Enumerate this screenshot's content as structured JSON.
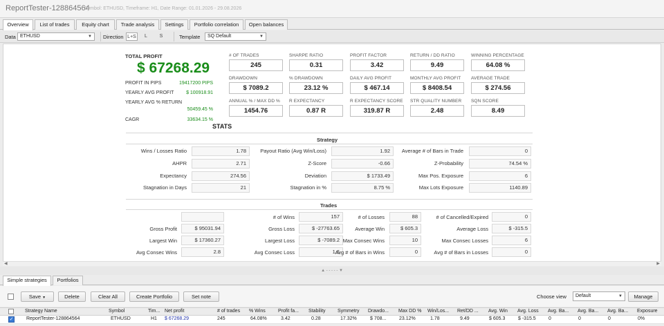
{
  "window": {
    "title": "ReportTester-128864564",
    "subtitle": "Symbol: ETHUSD, Timeframe: H1, Date Range: 01.01.2026 - 29.08.2026"
  },
  "tabs": [
    "Overview",
    "List of trades",
    "Equity chart",
    "Trade analysis",
    "Settings",
    "Portfolio correlation",
    "Open balances"
  ],
  "filter": {
    "data_label": "Data",
    "data_value": "ETHUSD",
    "direction_label": "Direction",
    "directions": [
      "L+S",
      "L",
      "S"
    ],
    "template_label": "Template",
    "template_value": "SQ Default"
  },
  "overview": {
    "total_profit_label": "TOTAL PROFIT",
    "total_profit": "$ 67268.29",
    "profit_in_pips_label": "PROFIT IN PIPS",
    "profit_in_pips": "19417200 PIPS",
    "yearly_avg_profit_label": "YEARLY AVG PROFIT",
    "yearly_avg_profit": "$ 100918.91",
    "yearly_avg_return_label": "YEARLY AVG % RETURN",
    "yearly_avg_return": "50459.45 %",
    "cagr_label": "CAGR",
    "cagr": "33634.15 %",
    "metrics": [
      {
        "label": "# OF TRADES",
        "value": "245"
      },
      {
        "label": "SHARPE RATIO",
        "value": "0.31"
      },
      {
        "label": "PROFIT FACTOR",
        "value": "3.42"
      },
      {
        "label": "RETURN / DD RATIO",
        "value": "9.49"
      },
      {
        "label": "WINNING PERCENTAGE",
        "value": "64.08 %"
      },
      {
        "label": "DRAWDOWN",
        "value": "$ 7089.2"
      },
      {
        "label": "% DRAWDOWN",
        "value": "23.12 %"
      },
      {
        "label": "DAILY AVG PROFIT",
        "value": "$ 467.14"
      },
      {
        "label": "MONTHLY AVG PROFIT",
        "value": "$ 8408.54"
      },
      {
        "label": "AVERAGE TRADE",
        "value": "$ 274.56"
      },
      {
        "label": "ANNUAL % / MAX DD %",
        "value": "1454.76"
      },
      {
        "label": "R EXPECTANCY",
        "value": "0.87 R"
      },
      {
        "label": "R EXPECTANCY SCORE",
        "value": "319.87 R"
      },
      {
        "label": "STR QUALITY NUMBER",
        "value": "2.48"
      },
      {
        "label": "SQN SCORE",
        "value": "8.49"
      }
    ]
  },
  "stats": {
    "title": "STATS",
    "strategy_title": "Strategy",
    "strategy": [
      {
        "label": "Wins / Losses Ratio",
        "value": "1.78"
      },
      {
        "label": "Payout Ratio (Avg Win/Loss)",
        "value": "1.92"
      },
      {
        "label": "Average # of Bars in Trade",
        "value": "0"
      },
      {
        "label": "AHPR",
        "value": "2.71"
      },
      {
        "label": "Z-Score",
        "value": "-0.66"
      },
      {
        "label": "Z-Probability",
        "value": "74.54 %"
      },
      {
        "label": "Expectancy",
        "value": "274.56"
      },
      {
        "label": "Deviation",
        "value": "$ 1733.49"
      },
      {
        "label": "Max Pos. Exposure",
        "value": "6"
      },
      {
        "label": "Stagnation in Days",
        "value": "21"
      },
      {
        "label": "Stagnation in %",
        "value": "8.75 %"
      },
      {
        "label": "Max Lots Exposure",
        "value": "1140.89"
      }
    ],
    "trades_title": "Trades",
    "trades": [
      {
        "label": "",
        "value": ""
      },
      {
        "label": "# of Wins",
        "value": "157"
      },
      {
        "label": "# of Losses",
        "value": "88"
      },
      {
        "label": "# of Cancelled/Expired",
        "value": "0"
      },
      {
        "label": "Gross Profit",
        "value": "$ 95031.94"
      },
      {
        "label": "Gross Loss",
        "value": "$ -27763.65"
      },
      {
        "label": "Average Win",
        "value": "$ 605.3"
      },
      {
        "label": "Average Loss",
        "value": "$ -315.5"
      },
      {
        "label": "Largest Win",
        "value": "$ 17360.27"
      },
      {
        "label": "Largest Loss",
        "value": "$ -7089.2"
      },
      {
        "label": "Max Consec Wins",
        "value": "10"
      },
      {
        "label": "Max Consec Losses",
        "value": "6"
      },
      {
        "label": "Avg Consec Wins",
        "value": "2.8"
      },
      {
        "label": "Avg Consec Loss",
        "value": "1.6"
      },
      {
        "label": "Avg # of Bars in Wins",
        "value": "0"
      },
      {
        "label": "Avg # of Bars in Losses",
        "value": "0"
      }
    ]
  },
  "splitter_glyph": "▲ - - - - - ▼",
  "bottom": {
    "tabs": [
      "Simple strategies",
      "Portfolios"
    ],
    "buttons": {
      "save": "Save",
      "delete": "Delete",
      "clear_all": "Clear All",
      "create_portfolio": "Create Portfolio",
      "set_note": "Set note",
      "manage": "Manage"
    },
    "choose_view_label": "Choose view",
    "choose_view_value": "Default",
    "columns": [
      "Strategy Name",
      "Symbol",
      "Tim...",
      "Net profit",
      "# of trades",
      "% Wins",
      "Profit fa...",
      "Stability",
      "Symmetry",
      "Drawdo...",
      "Max DD %",
      "Win/Los...",
      "Ret/DD ...",
      "Avg. Win",
      "Avg. Loss",
      "Avg. Ba...",
      "Avg. Ba...",
      "Avg. Ba...",
      "Avg. Ba...",
      "Exposure"
    ],
    "row": [
      "ReportTester-128864564",
      "ETHUSD",
      "H1",
      "$ 67268.29",
      "245",
      "64.08%",
      "3.42",
      "0.28",
      "17.32%",
      "$ 708...",
      "23.12%",
      "1.78",
      "9.49",
      "$ 605.3",
      "$ -315.5",
      "0",
      "0",
      "0",
      "0",
      "0%"
    ]
  }
}
